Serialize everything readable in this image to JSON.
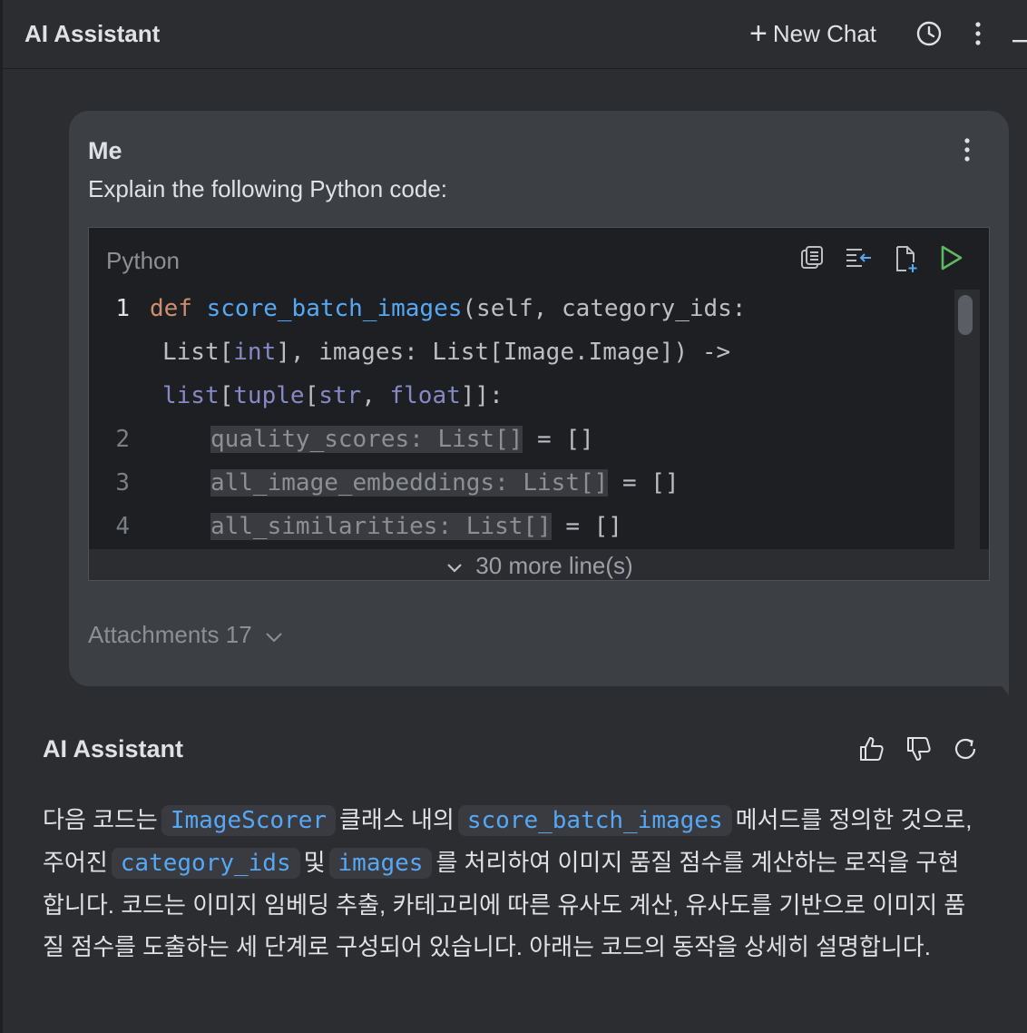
{
  "header": {
    "title": "AI Assistant",
    "new_chat_label": "New Chat"
  },
  "message": {
    "author": "Me",
    "text": "Explain the following Python code:",
    "code": {
      "language": "Python",
      "line_numbers": [
        "1",
        "2",
        "3",
        "4"
      ],
      "lines": {
        "l1": {
          "kw": "def",
          "fn": "score_batch_images",
          "p1": "(self, category_ids:"
        },
        "l1b": {
          "a": "List[",
          "b": "int",
          "c": "], images: List[Image.Image]) ->"
        },
        "l1c": {
          "a": "list",
          "b": "[",
          "c": "tuple",
          "d": "[",
          "e": "str",
          "f": ", ",
          "g": "float",
          "h": "]]:"
        },
        "l2": {
          "hl": "quality_scores: List[]",
          "rest": " = []"
        },
        "l3": {
          "hl": "all_image_embeddings: List[]",
          "rest": " = []"
        },
        "l4": {
          "hl": "all_similarities: List[]",
          "rest": " = []"
        }
      },
      "more_label": "30 more line(s)"
    },
    "attachments_label": "Attachments 17"
  },
  "reply": {
    "author": "AI Assistant",
    "p1": "다음 코드는",
    "c1": "ImageScorer",
    "p2": "클래스 내의",
    "c2": "score_batch_images",
    "p3": "메서드를 정의한 것으로, 주어진",
    "c3": "category_ids",
    "p4": "및",
    "c4": "images",
    "p5": "를 처리하여 이미지 품질 점수를 계산하는 로직을 구현합니다. 코드는 이미지 임베딩 추출, 카테고리에 따른 유사도 계산, 유사도를 기반으로 이미지 품질 점수를 도출하는 세 단계로 구성되어 있습니다. 아래는 코드의 동작을 상세히 설명합니다."
  },
  "icons": {
    "history": "clock-icon",
    "options": "kebab-icon",
    "copy": "copy-icon",
    "insert": "insert-at-caret-icon",
    "new_file": "new-file-icon",
    "run": "run-icon",
    "like": "thumbs-up-icon",
    "dislike": "thumbs-down-icon",
    "regenerate": "refresh-icon"
  },
  "colors": {
    "background": "#2b2d30",
    "card": "#3c3f44",
    "code_bg": "#1e1f22",
    "keyword": "#cf8e6d",
    "function": "#56a8f5",
    "builtin": "#8888c6",
    "run_green": "#5fb865"
  }
}
